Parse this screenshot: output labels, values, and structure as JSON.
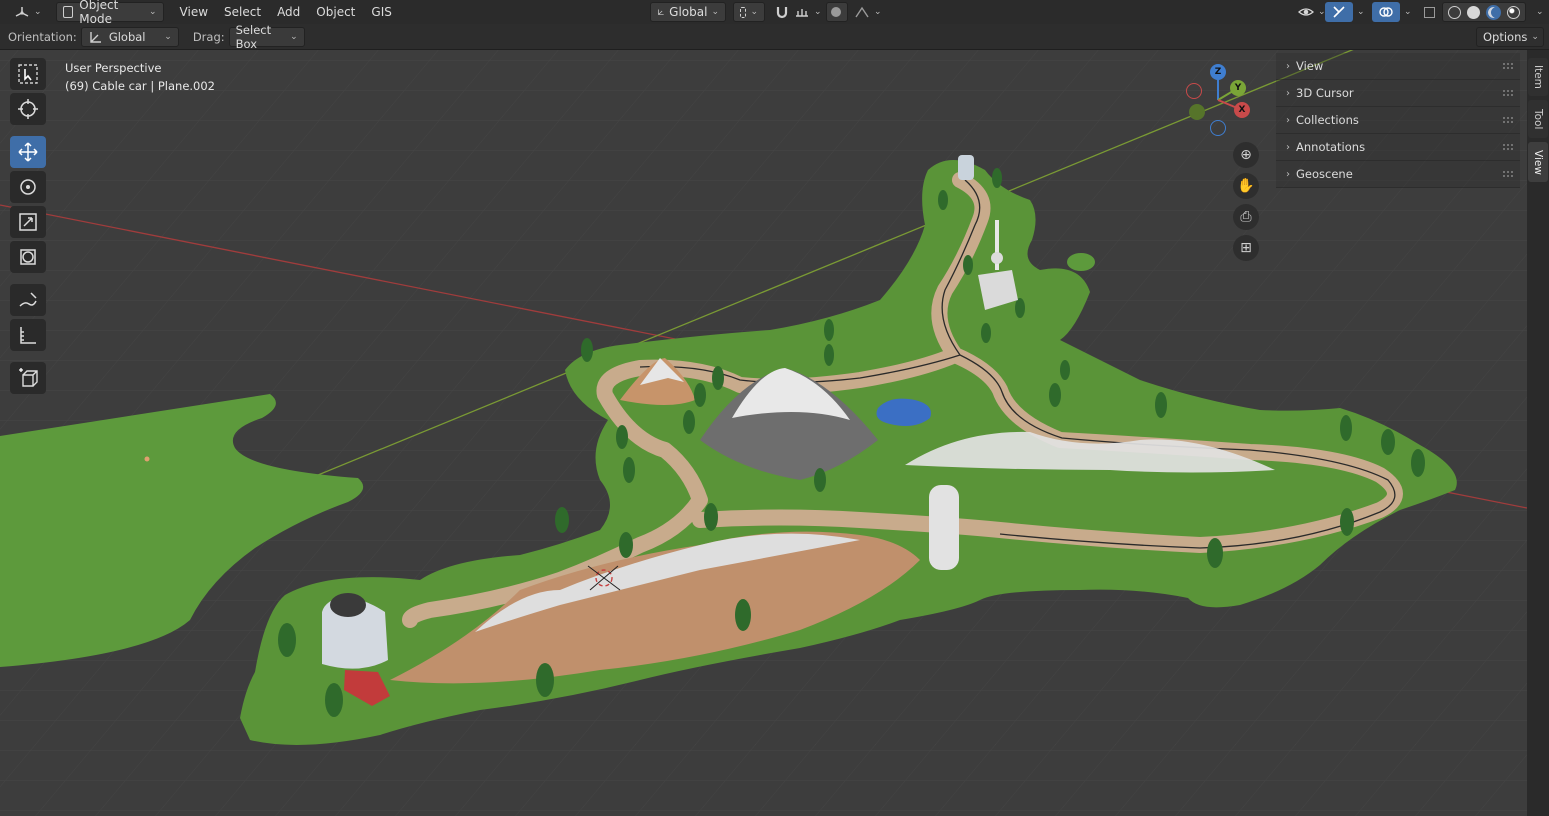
{
  "header": {
    "editor_type_icon": "3d-viewport-icon",
    "mode": "Object Mode",
    "menus": [
      "View",
      "Select",
      "Add",
      "Object",
      "GIS"
    ],
    "transform_orientation": "Global"
  },
  "tool_header": {
    "orientation_label": "Orientation:",
    "orientation_value": "Global",
    "drag_label": "Drag:",
    "drag_value": "Select Box",
    "options_label": "Options"
  },
  "viewport": {
    "perspective": "User Perspective",
    "object_info": "(69) Cable car | Plane.002",
    "gizmo_axes": {
      "x": "X",
      "y": "Y",
      "z": "Z"
    }
  },
  "toolbar": {
    "tools": [
      "select-box",
      "cursor",
      "move",
      "rotate",
      "scale",
      "transform",
      "annotate",
      "measure",
      "add-cube"
    ],
    "active_tool": "move"
  },
  "sidebar": {
    "panels": [
      "View",
      "3D Cursor",
      "Collections",
      "Annotations",
      "Geoscene"
    ],
    "tabs": [
      "Item",
      "Tool",
      "View"
    ],
    "active_tab": "View"
  },
  "colors": {
    "accent": "#3f6ea8",
    "grass": "#5d9a3c",
    "road": "#c8ab8c",
    "x_axis": "#c84a4a",
    "y_axis": "#7aa537",
    "z_axis": "#3f7ed0"
  }
}
